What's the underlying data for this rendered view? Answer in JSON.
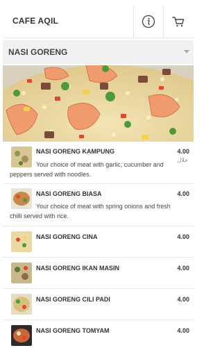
{
  "header": {
    "title": "CAFE AQIL",
    "info_icon": "info-icon",
    "cart_icon": "cart-icon"
  },
  "category": {
    "selected": "NASI GORENG"
  },
  "items": [
    {
      "name": "NASI GORENG KAMPUNG",
      "price": "4.00",
      "description": "Your choice of meat with garlic, cucumber and peppers served with noodles.",
      "badge": "حلال"
    },
    {
      "name": "NASI GORENG BIASA",
      "price": "4.00",
      "description": "Your choice of meat with spring onions and fresh chilli served with rice."
    },
    {
      "name": "NASI GORENG CINA",
      "price": "4.00"
    },
    {
      "name": "NASI GORENG IKAN MASIN",
      "price": "4.00"
    },
    {
      "name": "NASI GORENG CILI PADI",
      "price": "4.00"
    },
    {
      "name": "NASI GORENG TOMYAM",
      "price": "4.00"
    }
  ]
}
